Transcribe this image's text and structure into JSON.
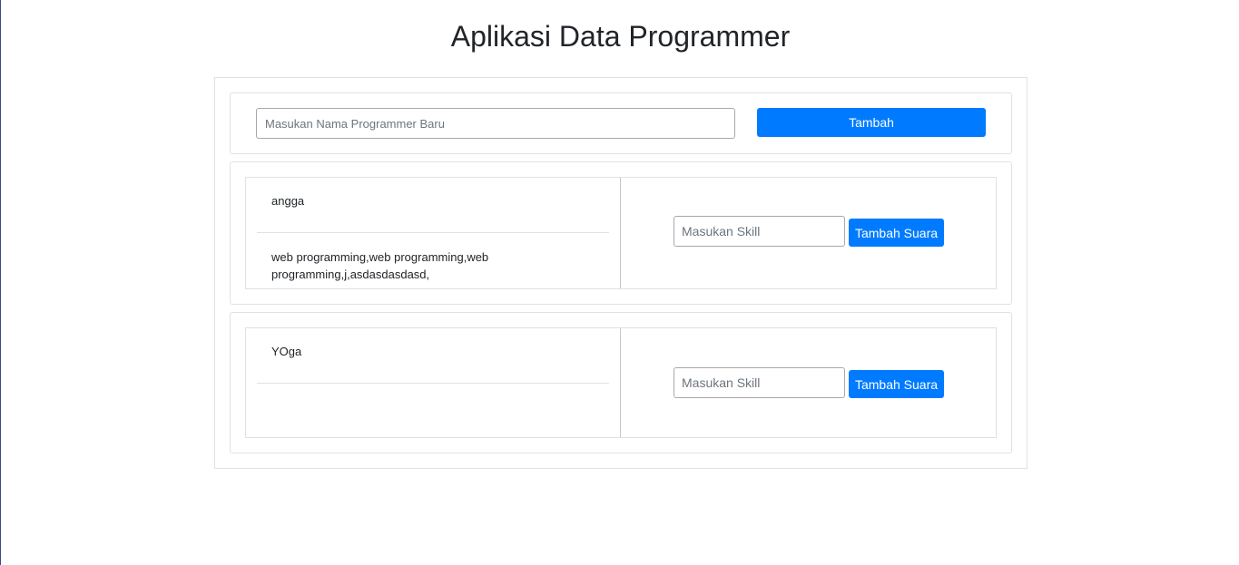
{
  "app": {
    "title": "Aplikasi Data Programmer"
  },
  "add_form": {
    "name_placeholder": "Masukan Nama Programmer Baru",
    "name_value": "",
    "add_label": "Tambah"
  },
  "programmers": [
    {
      "name": "angga",
      "skills": "web programming,web programming,web programming,j,asdasdasdasd,",
      "skill_placeholder": "Masukan Skill",
      "skill_value": "",
      "button_label": "Tambah Suara"
    },
    {
      "name": "YOga",
      "skills": "",
      "skill_placeholder": "Masukan Skill",
      "skill_value": "",
      "button_label": "Tambah Suara"
    }
  ],
  "colors": {
    "primary": "#007bff",
    "border": "#dee2e6",
    "text": "#212529"
  }
}
